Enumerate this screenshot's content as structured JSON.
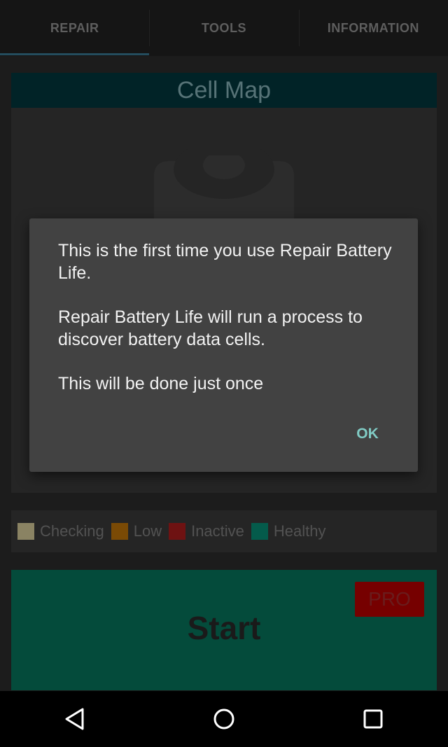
{
  "tabs": [
    {
      "label": "REPAIR",
      "active": true
    },
    {
      "label": "TOOLS",
      "active": false
    },
    {
      "label": "INFORMATION",
      "active": false
    }
  ],
  "cell_map": {
    "title": "Cell Map",
    "icon": "battery-icon"
  },
  "legend": [
    {
      "label": "Checking",
      "color": "#8a8363"
    },
    {
      "label": "Low",
      "color": "#7a4a05"
    },
    {
      "label": "Inactive",
      "color": "#6e1212"
    },
    {
      "label": "Healthy",
      "color": "#045b4b"
    }
  ],
  "start_button": {
    "label": "Start",
    "badge": "PRO"
  },
  "dialog": {
    "line1": "This is the first time you use Repair Battery Life.",
    "line2": "Repair Battery Life will run a process to discover battery data cells.",
    "line3": "This will be done just once",
    "ok_label": "OK"
  },
  "navbar": {
    "back_icon": "back-triangle-icon",
    "home_icon": "home-circle-icon",
    "recents_icon": "recents-square-icon"
  },
  "colors": {
    "accent": "#80cbc4",
    "header_bg": "#012327",
    "start_bg": "#044b3b",
    "pro_bg": "#760000"
  }
}
